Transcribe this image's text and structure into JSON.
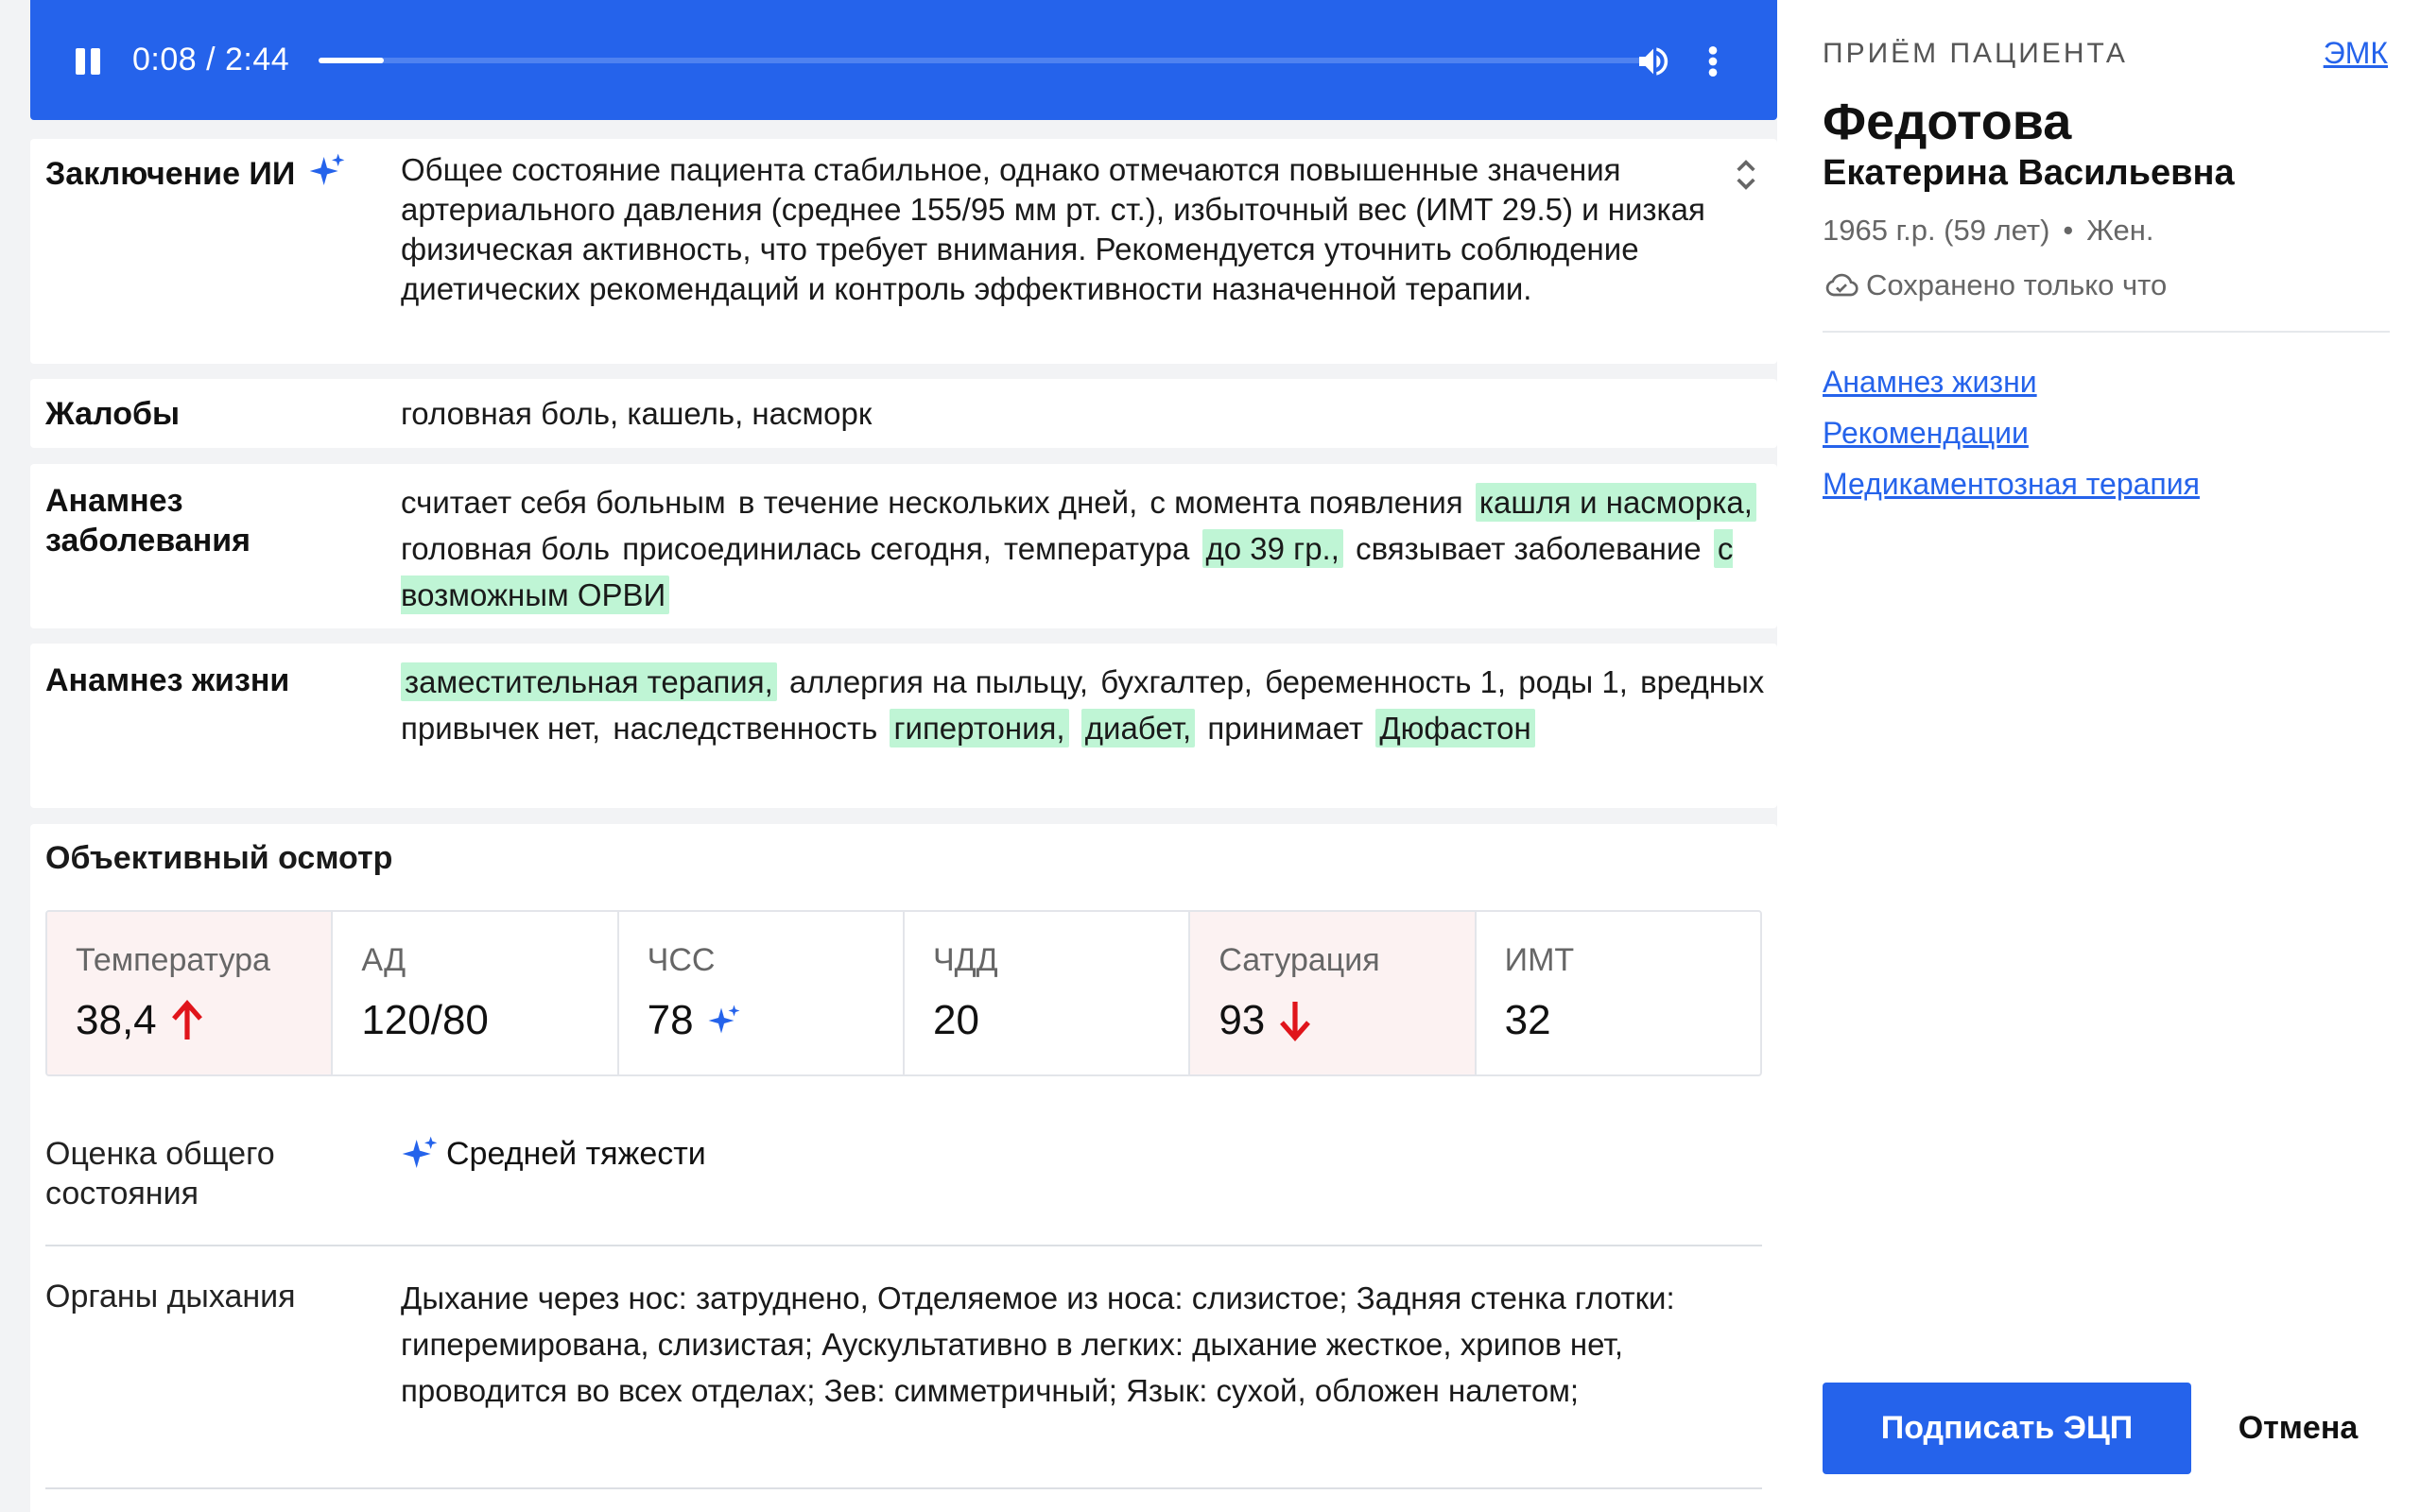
{
  "player": {
    "time": "0:08 / 2:44",
    "progress": 0.049,
    "pause_icon": "pause-icon",
    "volume_icon": "volume-icon",
    "more_icon": "more-vertical-icon"
  },
  "ai_conclusion": {
    "label": "Заключение ИИ",
    "text": "Общее состояние пациента стабильное, однако отмечаются повышенные значения артериального давления (среднее 155/95 мм рт. ст.), избыточный вес (ИМТ 29.5) и низкая физическая активность, что требует внимания. Рекомендуется уточнить соблюдение диетических рекомендаций и контроль эффективности назначенной терапии."
  },
  "complaints": {
    "label": "Жалобы",
    "text": "головная боль, кашель, насморк"
  },
  "disease_history": {
    "label": "Анамнез заболевания",
    "chips": [
      {
        "text": "считает себя больным",
        "hl": false
      },
      {
        "text": "в течение нескольких дней,",
        "hl": false
      },
      {
        "text": "с момента появления",
        "hl": false
      },
      {
        "text": "кашля и насморка,",
        "hl": true
      },
      {
        "text": "головная боль",
        "hl": false
      },
      {
        "text": "присоединилась сегодня,",
        "hl": false
      },
      {
        "text": "температура",
        "hl": false
      },
      {
        "text": "до 39 гр.,",
        "hl": true
      },
      {
        "text": "связывает заболевание",
        "hl": false
      },
      {
        "text": "с возможным ОРВИ",
        "hl": true
      }
    ]
  },
  "life_history": {
    "label": "Анамнез жизни",
    "chips": [
      {
        "text": "заместительная терапия,",
        "hl": true
      },
      {
        "text": "аллергия на пыльцу,",
        "hl": false
      },
      {
        "text": "бухгалтер,",
        "hl": false
      },
      {
        "text": "беременность 1,",
        "hl": false
      },
      {
        "text": "роды 1,",
        "hl": false
      },
      {
        "text": "вредных привычек нет,",
        "hl": false
      },
      {
        "text": "наследственность",
        "hl": false
      },
      {
        "text": "гипертония,",
        "hl": true
      },
      {
        "text": "диабет,",
        "hl": true
      },
      {
        "text": "принимает",
        "hl": false
      },
      {
        "text": "Дюфастон",
        "hl": true
      }
    ]
  },
  "exam": {
    "title": "Объективный осмотр",
    "vitals": [
      {
        "label": "Температура",
        "value": "38,4",
        "flag": "up",
        "warn": true
      },
      {
        "label": "АД",
        "value": "120/80",
        "flag": "",
        "warn": false
      },
      {
        "label": "ЧСС",
        "value": "78",
        "flag": "ai",
        "warn": false
      },
      {
        "label": "ЧДД",
        "value": "20",
        "flag": "",
        "warn": false
      },
      {
        "label": "Сатурация",
        "value": "93",
        "flag": "down",
        "warn": true
      },
      {
        "label": "ИМТ",
        "value": "32",
        "flag": "",
        "warn": false
      }
    ],
    "assessment_label": "Оценка общего состояния",
    "assessment_value": "Средней тяжести",
    "respiratory_label": "Органы дыхания",
    "respiratory_text": "Дыхание через нос: затруднено, Отделяемое из носа: слизистое; Задняя стенка глотки: гиперемирована, слизистая; Аускультативно в легких: дыхание жесткое, хрипов нет, проводится во всех отделах; Зев: симметричный; Язык: сухой, обложен налетом;"
  },
  "patient_panel": {
    "overline": "ПРИЁМ ПАЦИЕНТА",
    "emk_link": "ЭМК",
    "surname": "Федотова",
    "given_names": "Екатерина Васильевна",
    "birth": "1965 г.р. (59 лет)",
    "sex": "Жен.",
    "saved_status": "Сохранено только что",
    "links": [
      "Анамнез жизни",
      "Рекомендации",
      "Медикаментозная терапия"
    ],
    "sign_button": "Подписать ЭЦП",
    "cancel_button": "Отмена"
  },
  "colors": {
    "accent": "#2563eb",
    "highlight": "#bff5d5",
    "alert": "#e0151b",
    "warn_bg": "#fcf2f2"
  }
}
